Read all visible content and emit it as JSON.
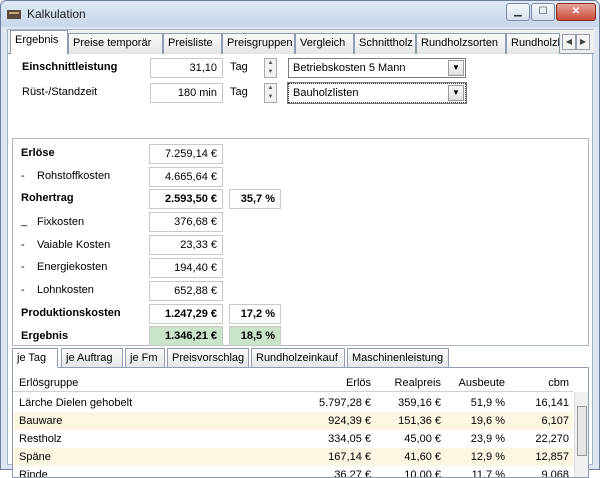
{
  "window": {
    "title": "Kalkulation"
  },
  "tabs": [
    "Ergebnis",
    "Preise temporär",
    "Preisliste",
    "Preisgruppen",
    "Vergleich",
    "Schnittholz",
    "Rundholzsorten",
    "Rundholzl"
  ],
  "einschnitt": {
    "label": "Einschnittleistung",
    "value": "31,10",
    "unit": "Tag",
    "combo": "Betriebskosten 5 Mann"
  },
  "ruest": {
    "label": "Rüst-/Standzeit",
    "value": "180 min",
    "unit": "Tag",
    "combo": "Bauholzlisten"
  },
  "summary": {
    "erloese": {
      "label": "Erlöse",
      "value": "7.259,14 €"
    },
    "rohstoff": {
      "label": "Rohstoffkosten",
      "value": "4.665,64 €"
    },
    "rohertrag": {
      "label": "Rohertrag",
      "value": "2.593,50 €",
      "percent": "35,7 %"
    },
    "fixkosten": {
      "label": "Fixkosten",
      "value": "376,68 €"
    },
    "variable": {
      "label": "Vaiable Kosten",
      "value": "23,33 €"
    },
    "energie": {
      "label": "Energiekosten",
      "value": "194,40 €"
    },
    "lohn": {
      "label": "Lohnkosten",
      "value": "652,88 €"
    },
    "produktion": {
      "label": "Produktionskosten",
      "value": "1.247,29 €",
      "percent": "17,2 %"
    },
    "ergebnis": {
      "label": "Ergebnis",
      "value": "1.346,21 €",
      "percent": "18,5 %"
    }
  },
  "bottom_tabs": [
    "je Tag",
    "je Auftrag",
    "je Fm",
    "Preisvorschlag",
    "Rundholzeinkauf",
    "Maschinenleistung"
  ],
  "grid": {
    "headers": [
      "Erlösgruppe",
      "Erlös",
      "Realpreis",
      "Ausbeute",
      "cbm"
    ],
    "rows": [
      [
        "Lärche Dielen gehobelt",
        "5.797,28 €",
        "359,16 €",
        "51,9 %",
        "16,141"
      ],
      [
        "Bauware",
        "924,39 €",
        "151,36 €",
        "19,6 %",
        "6,107"
      ],
      [
        "Restholz",
        "334,05 €",
        "45,00 €",
        "23,9 %",
        "22,270"
      ],
      [
        "Späne",
        "167,14 €",
        "41,60 €",
        "12,9 %",
        "12,857"
      ],
      [
        "Rinde",
        "36,27 €",
        "10,00 €",
        "11,7 %",
        "9,068"
      ]
    ]
  }
}
